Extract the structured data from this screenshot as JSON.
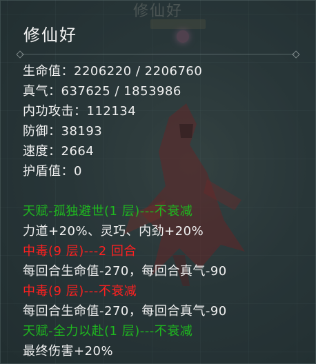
{
  "background": {
    "title": "修仙好"
  },
  "character": {
    "name": "修仙好"
  },
  "stats": [
    {
      "label": "生命值",
      "value": "2206220 / 2206760"
    },
    {
      "label": "真气",
      "value": "637625 / 1853986"
    },
    {
      "label": "内功攻击",
      "value": "112134"
    },
    {
      "label": "防御",
      "value": "38193"
    },
    {
      "label": "速度",
      "value": "2664"
    },
    {
      "label": "护盾值",
      "value": "0"
    }
  ],
  "stat_lines": [
    "生命值：2206220 / 2206760",
    "真气：637625 / 1853986",
    "内功攻击：112134",
    "防御：38193",
    "速度：2664",
    "护盾值：0"
  ],
  "effects": [
    {
      "title": "天赋-孤独避世(1 层)---不衰减",
      "title_color": "#1fb81f",
      "desc": "力道+20%、灵巧、内劲+20%"
    },
    {
      "title": "中毒(9 层)---2 回合",
      "title_color": "#ff2020",
      "desc": "每回合生命值-270，每回合真气-90"
    },
    {
      "title": "中毒(9 层)---不衰减",
      "title_color": "#ff2020",
      "desc": "每回合生命值-270，每回合真气-90"
    },
    {
      "title": "天赋-全力以赴(1 层)---不衰减",
      "title_color": "#1fb81f",
      "desc": "最终伤害+20%"
    }
  ]
}
